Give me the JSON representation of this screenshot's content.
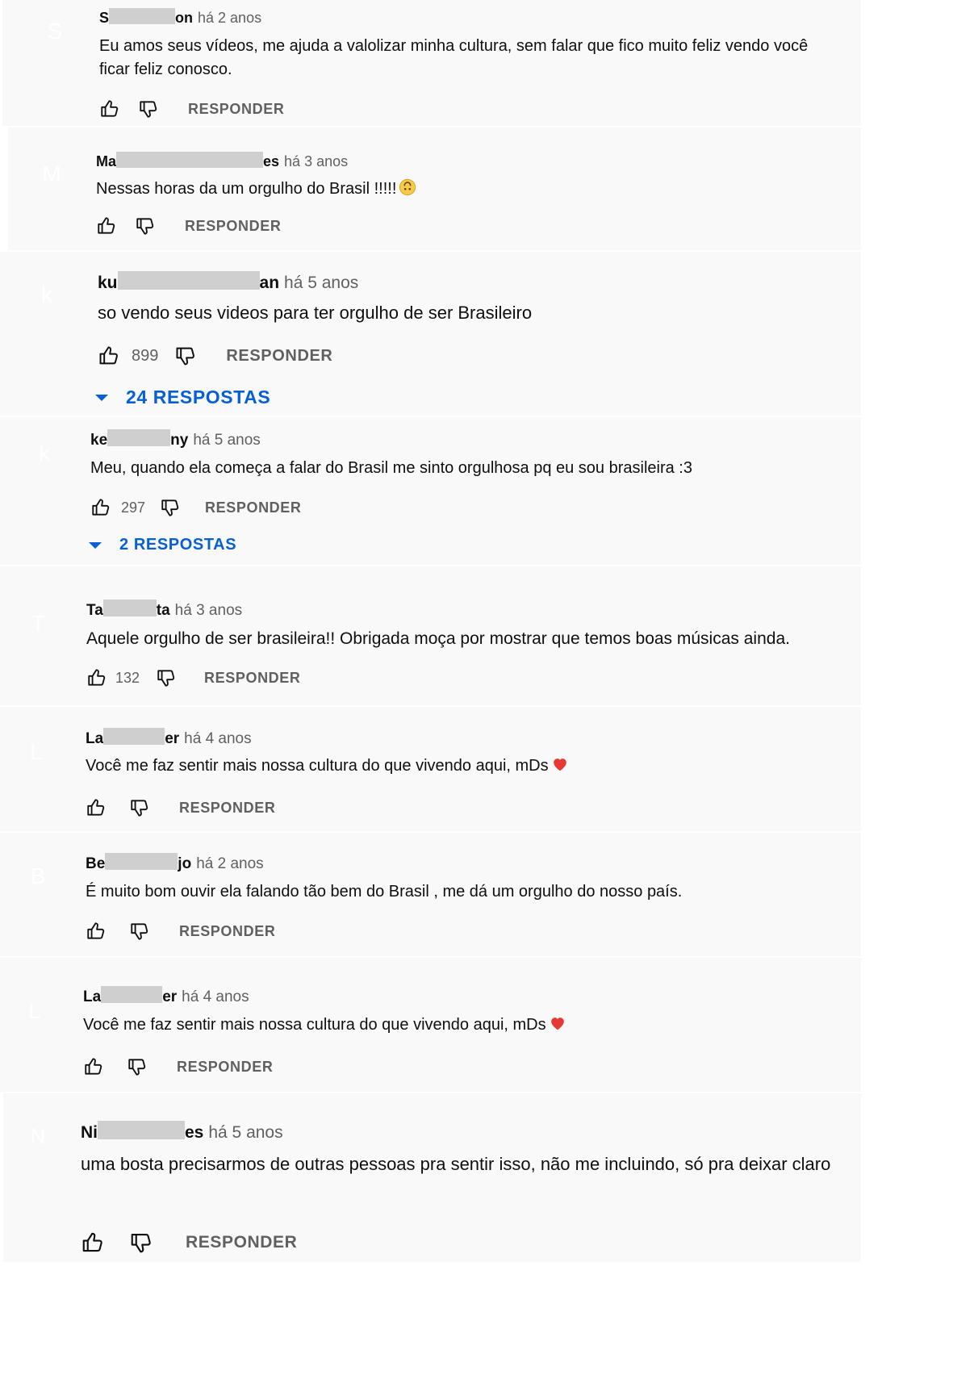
{
  "labels": {
    "reply": "RESPONDER"
  },
  "colors": {
    "link_blue": "#065fd4",
    "secondary_text": "#606060",
    "redaction": "#cfcfcf",
    "background": "#f9f9f9"
  },
  "comments": [
    {
      "initial": "S",
      "avatar_color": "#030303",
      "name_start": "S",
      "name_end": "on",
      "time": "há 2 anos",
      "text": "Eu amos seus vídeos, me ajuda a valolizar minha cultura, sem falar que fico muito feliz vendo você ficar feliz conosco.",
      "likes": "",
      "replies": ""
    },
    {
      "initial": "M",
      "avatar_color": "#9c4db4",
      "name_start": "Ma",
      "name_end": "es",
      "time": "há 3 anos",
      "text": "Nessas horas da um orgulho do Brasil !!!!!",
      "emoji": "upside-down-face",
      "likes": "",
      "replies": ""
    },
    {
      "initial": "k",
      "avatar_color": "#c2c2c2",
      "name_start": "ku",
      "name_end": "an",
      "time": "há 5 anos",
      "text": "so vendo seus videos para ter orgulho de ser Brasileiro",
      "likes": "899",
      "replies": "24 RESPOSTAS"
    },
    {
      "initial": "k",
      "avatar_color": "#f08339",
      "name_start": "ke",
      "name_end": "ny",
      "time": "há 5 anos",
      "text": "Meu, quando ela começa  a falar do Brasil  me sinto orgulhosa pq eu sou brasileira :3",
      "likes": "297",
      "replies": "2 RESPOSTAS"
    },
    {
      "initial": "T",
      "avatar_color": "#757575",
      "name_start": "Ta",
      "name_end": "ta",
      "time": "há 3 anos",
      "text": "Aquele orgulho de ser brasileira!! Obrigada moça por mostrar que temos boas músicas ainda.",
      "likes": "132",
      "replies": ""
    },
    {
      "initial": "L",
      "avatar_color": "#45b158",
      "name_start": "La",
      "name_end": "er",
      "time": "há 4 anos",
      "text": "Você me faz sentir mais nossa cultura do que vivendo aqui, mDs",
      "emoji": "red-heart",
      "likes": "",
      "replies": ""
    },
    {
      "initial": "B",
      "avatar_color": "#f6ca42",
      "name_start": "Be",
      "name_end": "jo",
      "time": "há 2 anos",
      "text": "É muito bom ouvir ela falando tão bem do Brasil , me dá um orgulho do nosso país.",
      "likes": "",
      "replies": ""
    },
    {
      "initial": "L",
      "avatar_color": "#9c4db4",
      "name_start": "La",
      "name_end": "er",
      "time": "há 4 anos",
      "text": "Você me faz sentir mais nossa cultura do que vivendo aqui, mDs",
      "emoji": "red-heart",
      "likes": "",
      "replies": ""
    },
    {
      "initial": "N",
      "avatar_color": "#bb7d61",
      "name_start": "Ni",
      "name_end": "es",
      "time": "há 5 anos",
      "text": "uma bosta precisarmos de outras pessoas pra sentir isso, não me incluindo, só pra deixar claro",
      "likes": "",
      "replies": ""
    }
  ]
}
